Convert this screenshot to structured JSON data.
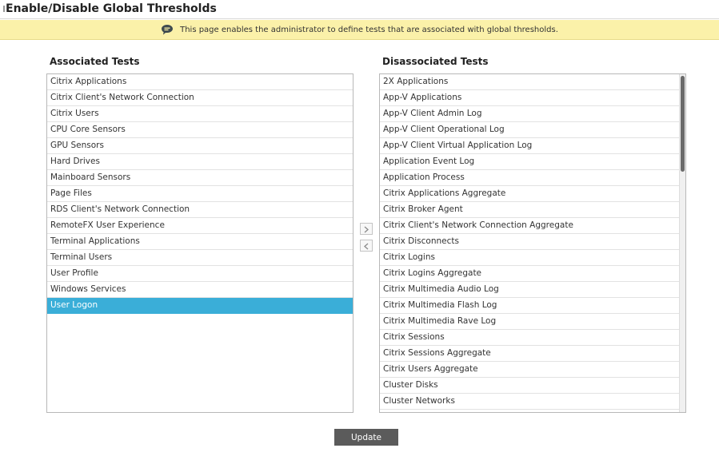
{
  "page": {
    "title": "Enable/Disable Global Thresholds"
  },
  "info": {
    "message": "This page enables the administrator to define tests that are associated with global thresholds."
  },
  "associated": {
    "heading": "Associated Tests",
    "items": [
      "Citrix Applications",
      "Citrix Client's Network Connection",
      "Citrix Users",
      "CPU Core Sensors",
      "GPU Sensors",
      "Hard Drives",
      "Mainboard Sensors",
      "Page Files",
      "RDS Client's Network Connection",
      "RemoteFX User Experience",
      "Terminal Applications",
      "Terminal Users",
      "User Profile",
      "Windows Services",
      "User Logon"
    ],
    "selected_item": "User Logon"
  },
  "disassociated": {
    "heading": "Disassociated Tests",
    "items": [
      "2X Applications",
      "App-V Applications",
      "App-V Client Admin Log",
      "App-V Client Operational Log",
      "App-V Client Virtual Application Log",
      "Application Event Log",
      "Application Process",
      "Citrix Applications Aggregate",
      "Citrix Broker Agent",
      "Citrix Client's Network Connection Aggregate",
      "Citrix Disconnects",
      "Citrix Logins",
      "Citrix Logins Aggregate",
      "Citrix Multimedia Audio Log",
      "Citrix Multimedia Flash Log",
      "Citrix Multimedia Rave Log",
      "Citrix Sessions",
      "Citrix Sessions Aggregate",
      "Citrix Users Aggregate",
      "Cluster Disks",
      "Cluster Networks"
    ]
  },
  "controls": {
    "move_right_icon": "chevron-right-icon",
    "move_left_icon": "chevron-left-icon",
    "update_label": "Update"
  },
  "colors": {
    "info_bar": "#fbf1a9",
    "selected_row": "#3aaed8",
    "update_button": "#5b5b5b"
  }
}
